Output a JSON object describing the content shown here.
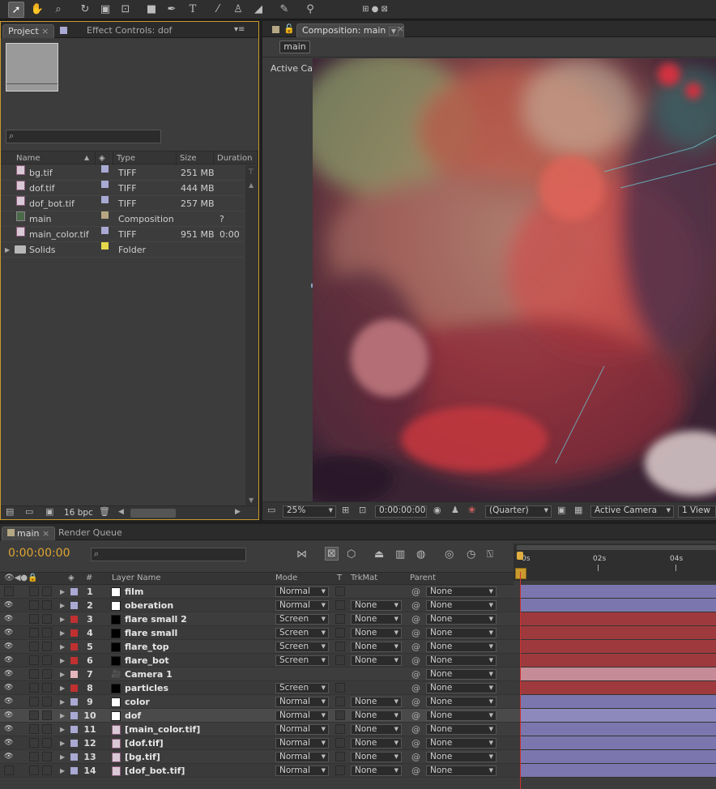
{
  "toolbar": {
    "icons": [
      "selection-tool-icon",
      "hand-tool-icon",
      "zoom-tool-icon",
      "rotation-tool-icon",
      "camera-orbit-icon",
      "pan-behind-icon",
      "rectangle-tool-icon",
      "pen-tool-icon",
      "type-tool-icon",
      "brush-tool-icon",
      "clone-stamp-icon",
      "eraser-tool-icon",
      "roto-brush-icon",
      "puppet-pin-icon",
      "axis-mode-icon"
    ]
  },
  "project": {
    "tab_project": "Project",
    "tab_effect_controls": "Effect Controls: dof",
    "columns": {
      "name": "Name",
      "type": "Type",
      "size": "Size",
      "duration": "Duration"
    },
    "items": [
      {
        "name": "bg.tif",
        "type": "TIFF",
        "size": "251 MB",
        "duration": "",
        "label_color": "#a9a9d4"
      },
      {
        "name": "dof.tif",
        "type": "TIFF",
        "size": "444 MB",
        "duration": "",
        "label_color": "#a9a9d4"
      },
      {
        "name": "dof_bot.tif",
        "type": "TIFF",
        "size": "257 MB",
        "duration": "",
        "label_color": "#a9a9d4"
      },
      {
        "name": "main",
        "type": "Composition",
        "size": "",
        "duration": "? 0:00",
        "label_color": "#b5a783"
      },
      {
        "name": "main_color.tif",
        "type": "TIFF",
        "size": "951 MB",
        "duration": "",
        "label_color": "#a9a9d4"
      },
      {
        "name": "Solids",
        "type": "Folder",
        "size": "",
        "duration": "",
        "label_color": "#e5d84b"
      }
    ],
    "bpc": "16 bpc"
  },
  "composition": {
    "tab": "Composition: main",
    "subtab": "main",
    "camera_label": "Active Camera",
    "zoom": "25%",
    "timecode": "0:00:00:00",
    "resolution": "(Quarter)",
    "view": "Active Camera",
    "views": "1 View"
  },
  "timeline": {
    "tab_main": "main",
    "tab_render_queue": "Render Queue",
    "current_time": "0:00:00:00",
    "columns": {
      "num": "#",
      "layer_name": "Layer Name",
      "mode": "Mode",
      "t": "T",
      "trkmat": "TrkMat",
      "parent": "Parent"
    },
    "ruler": [
      "0s",
      "02s",
      "04s"
    ],
    "layers": [
      {
        "num": "1",
        "name": "film",
        "mode": "Normal",
        "trkmat": "",
        "parent": "None",
        "label": "#a9a9d4",
        "swatch": "#ffffff",
        "visible": false,
        "bar": "#7b77ae"
      },
      {
        "num": "2",
        "name": "oberation",
        "mode": "Normal",
        "trkmat": "None",
        "parent": "None",
        "label": "#a9a9d4",
        "swatch": "#ffffff",
        "visible": true,
        "bar": "#7b77ae"
      },
      {
        "num": "3",
        "name": "flare small 2",
        "mode": "Screen",
        "trkmat": "None",
        "parent": "None",
        "label": "#c03030",
        "swatch": "#000000",
        "visible": true,
        "bar": "#9e3a3d"
      },
      {
        "num": "4",
        "name": "flare small",
        "mode": "Screen",
        "trkmat": "None",
        "parent": "None",
        "label": "#c03030",
        "swatch": "#000000",
        "visible": true,
        "bar": "#9e3a3d"
      },
      {
        "num": "5",
        "name": "flare_top",
        "mode": "Screen",
        "trkmat": "None",
        "parent": "None",
        "label": "#c03030",
        "swatch": "#000000",
        "visible": true,
        "bar": "#9e3a3d"
      },
      {
        "num": "6",
        "name": "flare_bot",
        "mode": "Screen",
        "trkmat": "None",
        "parent": "None",
        "label": "#c03030",
        "swatch": "#000000",
        "visible": true,
        "bar": "#9e3a3d"
      },
      {
        "num": "7",
        "name": "Camera 1",
        "mode": "",
        "trkmat": "",
        "parent": "None",
        "label": "#e3b7bd",
        "swatch": "camera",
        "visible": true,
        "bar": "#c58c98"
      },
      {
        "num": "8",
        "name": "particles",
        "mode": "Screen",
        "trkmat": "",
        "parent": "None",
        "label": "#c03030",
        "swatch": "#000000",
        "visible": true,
        "bar": "#9e3a3d"
      },
      {
        "num": "9",
        "name": "color",
        "mode": "Normal",
        "trkmat": "None",
        "parent": "None",
        "label": "#a9a9d4",
        "swatch": "#ffffff",
        "visible": true,
        "bar": "#7b77ae"
      },
      {
        "num": "10",
        "name": "dof",
        "mode": "Normal",
        "trkmat": "None",
        "parent": "None",
        "label": "#a9a9d4",
        "swatch": "#ffffff",
        "visible": true,
        "bar": "#8d89bd",
        "selected": true
      },
      {
        "num": "11",
        "name": "[main_color.tif]",
        "mode": "Normal",
        "trkmat": "None",
        "parent": "None",
        "label": "#a9a9d4",
        "swatch": "file",
        "visible": true,
        "bar": "#7b77ae"
      },
      {
        "num": "12",
        "name": "[dof.tif]",
        "mode": "Normal",
        "trkmat": "None",
        "parent": "None",
        "label": "#a9a9d4",
        "swatch": "file",
        "visible": true,
        "bar": "#7b77ae"
      },
      {
        "num": "13",
        "name": "[bg.tif]",
        "mode": "Normal",
        "trkmat": "None",
        "parent": "None",
        "label": "#a9a9d4",
        "swatch": "file",
        "visible": true,
        "bar": "#7b77ae"
      },
      {
        "num": "14",
        "name": "[dof_bot.tif]",
        "mode": "Normal",
        "trkmat": "None",
        "parent": "None",
        "label": "#a9a9d4",
        "swatch": "file",
        "visible": false,
        "bar": "#7b77ae"
      }
    ]
  }
}
